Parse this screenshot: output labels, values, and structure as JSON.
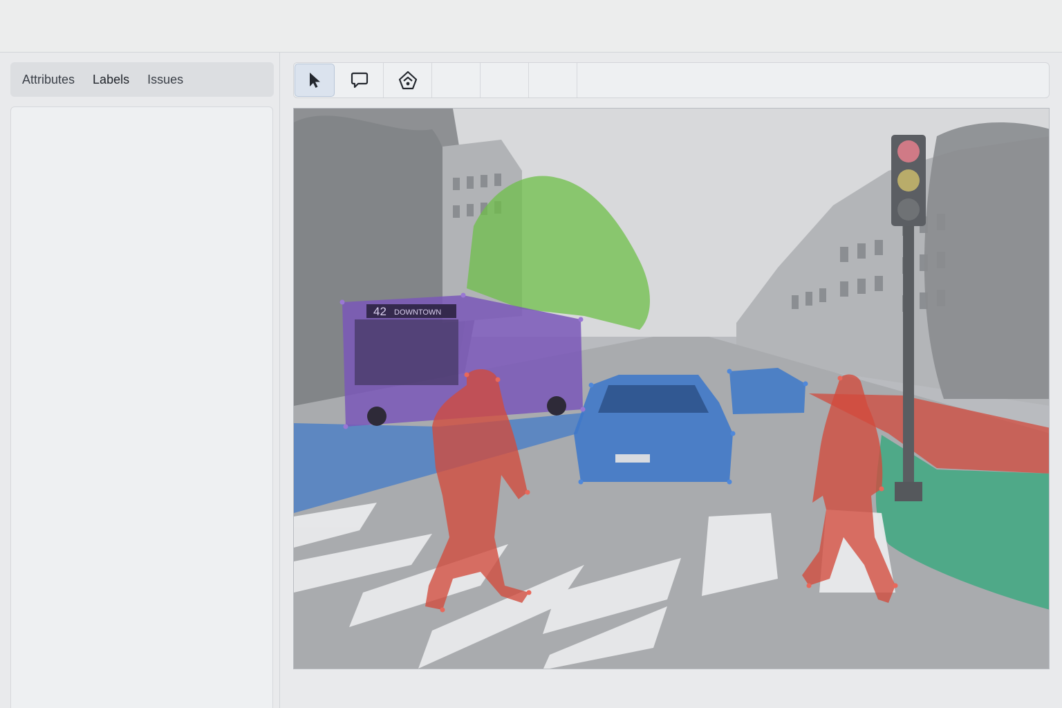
{
  "sidebar": {
    "tabs": [
      {
        "label": "Attributes"
      },
      {
        "label": "Labels"
      },
      {
        "label": "Issues"
      }
    ],
    "active_tab": "Labels"
  },
  "toolbar": {
    "tools": [
      {
        "name": "select",
        "icon": "cursor-arrow-icon",
        "selected": true
      },
      {
        "name": "comment",
        "icon": "speech-bubble-icon",
        "selected": false
      },
      {
        "name": "polygon",
        "icon": "polygon-nodes-icon",
        "selected": false
      }
    ]
  },
  "canvas": {
    "bus_route_number": "42",
    "bus_destination": "DOWNTOWN",
    "annotation_colors": {
      "person": "#d24a3c",
      "car": "#3d78c9",
      "bus": "#7a57b8",
      "tree": "#6fbf4a",
      "road": "#3d78c9",
      "sidewalk": "#29a878",
      "bike_lane": "#d24a3c"
    }
  }
}
